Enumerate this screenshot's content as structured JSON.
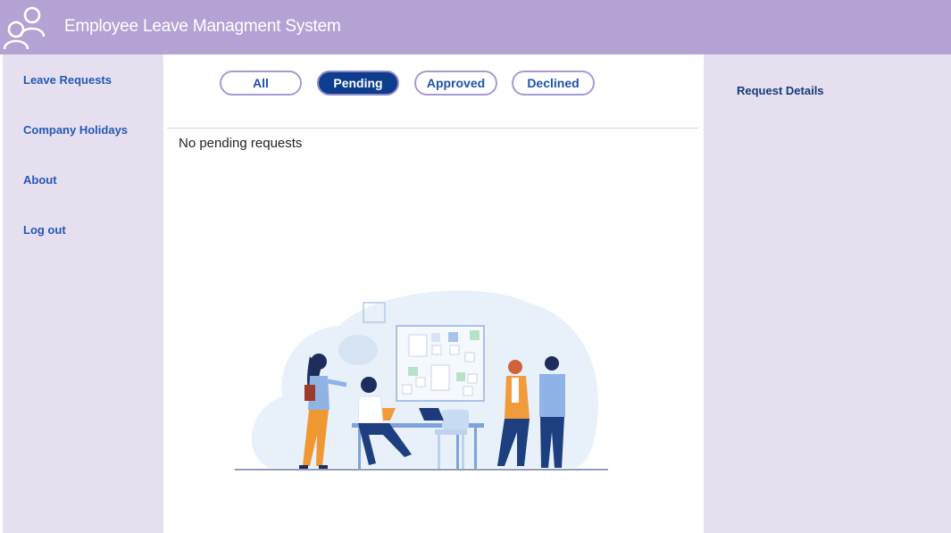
{
  "header": {
    "title": "Employee Leave Managment System",
    "logo_icon": "users-icon",
    "background": "#b4a2d4"
  },
  "sidebar": {
    "items": [
      {
        "label": "Leave Requests"
      },
      {
        "label": "Company Holidays"
      },
      {
        "label": "About"
      },
      {
        "label": "Log out"
      }
    ]
  },
  "main": {
    "tabs": [
      {
        "label": "All",
        "active": false
      },
      {
        "label": "Pending",
        "active": true
      },
      {
        "label": "Approved",
        "active": false
      },
      {
        "label": "Declined",
        "active": false
      }
    ],
    "empty_message": "No pending requests",
    "illustration_icon": "office-team-illustration"
  },
  "details": {
    "heading": "Request Details"
  },
  "colors": {
    "accent": "#0d3d8c",
    "link": "#2558b5",
    "panel_bg": "#e6dff0"
  }
}
